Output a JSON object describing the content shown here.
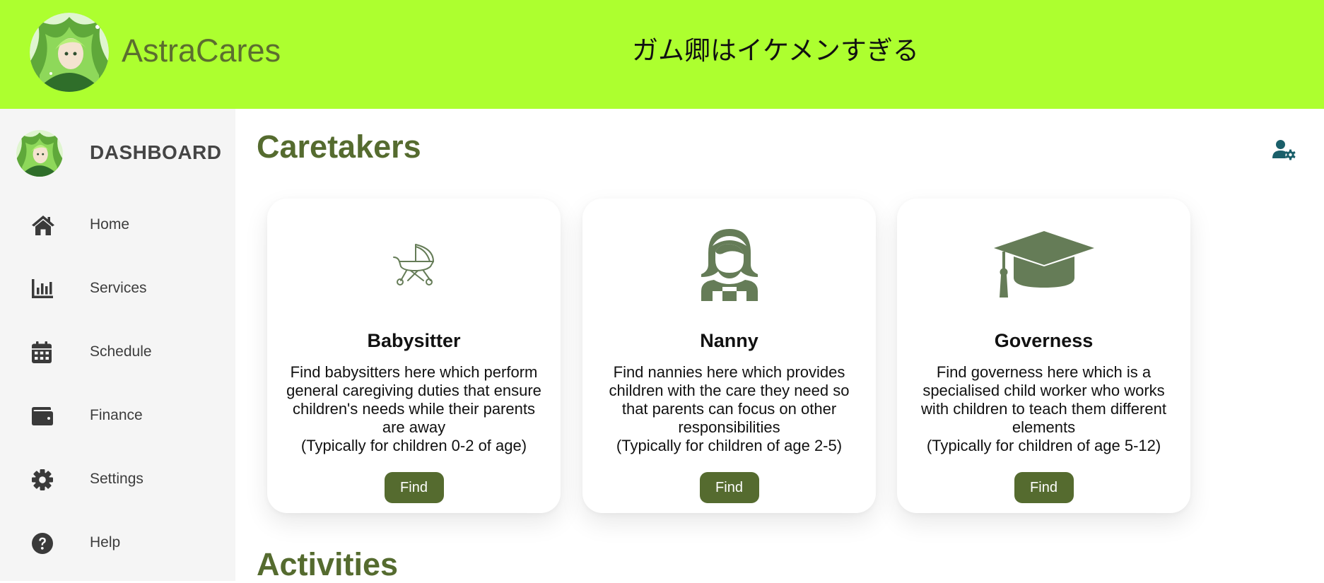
{
  "app": {
    "brand_name": "AstraCares",
    "banner_text": "ガム卿はイケメンすぎる"
  },
  "sidebar": {
    "title": "DASHBOARD",
    "items": [
      {
        "label": "Home",
        "icon": "home-icon"
      },
      {
        "label": "Services",
        "icon": "chart-icon"
      },
      {
        "label": "Schedule",
        "icon": "calendar-icon"
      },
      {
        "label": "Finance",
        "icon": "wallet-icon"
      },
      {
        "label": "Settings",
        "icon": "gear-icon"
      },
      {
        "label": "Help",
        "icon": "help-icon"
      }
    ]
  },
  "main": {
    "caretakers_title": "Caretakers",
    "activities_title": "Activities",
    "cards": [
      {
        "title": "Babysitter",
        "icon": "baby-carriage-icon",
        "description": "Find babysitters here which perform general caregiving duties that ensure children's needs while their parents are away",
        "age_note": "(Typically for children 0-2 of age)",
        "button": "Find"
      },
      {
        "title": "Nanny",
        "icon": "nanny-icon",
        "description": "Find nannies here which provides children with the care they need so that parents can focus on other responsibilities",
        "age_note": "(Typically for children of age 2-5)",
        "button": "Find"
      },
      {
        "title": "Governess",
        "icon": "graduation-cap-icon",
        "description": "Find governess here which is a specialised child worker who works with children to teach them different elements",
        "age_note": "(Typically for children of age 5-12)",
        "button": "Find"
      }
    ]
  },
  "colors": {
    "banner": "#adff2f",
    "accent": "#556b2f",
    "icon_green": "#657c57",
    "sidebar_bg": "#f5f5f5",
    "user_settings_icon": "#1a5f6a"
  }
}
